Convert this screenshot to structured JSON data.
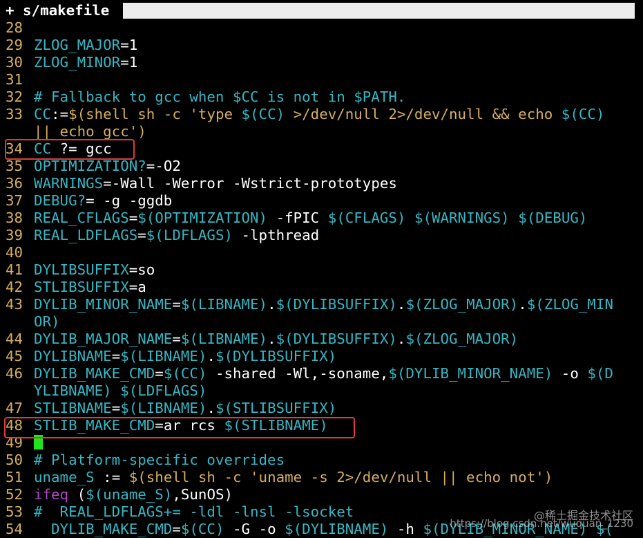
{
  "tab": {
    "title": "+ s/makefile"
  },
  "lines": [
    {
      "num": "28",
      "segs": []
    },
    {
      "num": "29",
      "segs": [
        {
          "t": "ZLOG_MAJOR",
          "c": "var"
        },
        {
          "t": "=1",
          "c": "txt"
        }
      ]
    },
    {
      "num": "30",
      "segs": [
        {
          "t": "ZLOG_MINOR",
          "c": "var"
        },
        {
          "t": "=1",
          "c": "txt"
        }
      ]
    },
    {
      "num": "31",
      "segs": []
    },
    {
      "num": "32",
      "segs": [
        {
          "t": "# Fallback to gcc when $CC is not in $PATH.",
          "c": "cmt"
        }
      ]
    },
    {
      "num": "33",
      "segs": [
        {
          "t": "CC",
          "c": "var"
        },
        {
          "t": ":=",
          "c": "txt"
        },
        {
          "t": "$(shell sh -c 'type ",
          "c": "str"
        },
        {
          "t": "$(CC)",
          "c": "var"
        },
        {
          "t": " >/dev/null 2>/dev/null && echo ",
          "c": "str"
        },
        {
          "t": "$(CC)",
          "c": "var"
        }
      ]
    },
    {
      "num": "",
      "segs": [
        {
          "t": "|| echo gcc')",
          "c": "str"
        }
      ]
    },
    {
      "num": "34",
      "segs": [
        {
          "t": "CC",
          "c": "var"
        },
        {
          "t": " ?= gcc",
          "c": "txt"
        }
      ]
    },
    {
      "num": "35",
      "segs": [
        {
          "t": "OPTIMIZATION?",
          "c": "var"
        },
        {
          "t": "=-O2",
          "c": "txt"
        }
      ]
    },
    {
      "num": "36",
      "segs": [
        {
          "t": "WARNINGS",
          "c": "var"
        },
        {
          "t": "=-Wall -Werror -Wstrict-prototypes",
          "c": "txt"
        }
      ]
    },
    {
      "num": "37",
      "segs": [
        {
          "t": "DEBUG?",
          "c": "var"
        },
        {
          "t": "= -g -ggdb",
          "c": "txt"
        }
      ]
    },
    {
      "num": "38",
      "segs": [
        {
          "t": "REAL_CFLAGS",
          "c": "var"
        },
        {
          "t": "=",
          "c": "txt"
        },
        {
          "t": "$(OPTIMIZATION)",
          "c": "var"
        },
        {
          "t": " -fPIC ",
          "c": "txt"
        },
        {
          "t": "$(CFLAGS)",
          "c": "var"
        },
        {
          "t": " ",
          "c": "txt"
        },
        {
          "t": "$(WARNINGS)",
          "c": "var"
        },
        {
          "t": " ",
          "c": "txt"
        },
        {
          "t": "$(DEBUG)",
          "c": "var"
        }
      ]
    },
    {
      "num": "39",
      "segs": [
        {
          "t": "REAL_LDFLAGS",
          "c": "var"
        },
        {
          "t": "=",
          "c": "txt"
        },
        {
          "t": "$(LDFLAGS)",
          "c": "var"
        },
        {
          "t": " -lpthread",
          "c": "txt"
        }
      ]
    },
    {
      "num": "40",
      "segs": []
    },
    {
      "num": "41",
      "segs": [
        {
          "t": "DYLIBSUFFIX",
          "c": "var"
        },
        {
          "t": "=so",
          "c": "txt"
        }
      ]
    },
    {
      "num": "42",
      "segs": [
        {
          "t": "STLIBSUFFIX",
          "c": "var"
        },
        {
          "t": "=a",
          "c": "txt"
        }
      ]
    },
    {
      "num": "43",
      "segs": [
        {
          "t": "DYLIB_MINOR_NAME",
          "c": "var"
        },
        {
          "t": "=",
          "c": "txt"
        },
        {
          "t": "$(LIBNAME)",
          "c": "var"
        },
        {
          "t": ".",
          "c": "txt"
        },
        {
          "t": "$(DYLIBSUFFIX)",
          "c": "var"
        },
        {
          "t": ".",
          "c": "txt"
        },
        {
          "t": "$(ZLOG_MAJOR)",
          "c": "var"
        },
        {
          "t": ".",
          "c": "txt"
        },
        {
          "t": "$(ZLOG_MIN",
          "c": "var"
        }
      ]
    },
    {
      "num": "",
      "segs": [
        {
          "t": "OR)",
          "c": "var"
        }
      ]
    },
    {
      "num": "44",
      "segs": [
        {
          "t": "DYLIB_MAJOR_NAME",
          "c": "var"
        },
        {
          "t": "=",
          "c": "txt"
        },
        {
          "t": "$(LIBNAME)",
          "c": "var"
        },
        {
          "t": ".",
          "c": "txt"
        },
        {
          "t": "$(DYLIBSUFFIX)",
          "c": "var"
        },
        {
          "t": ".",
          "c": "txt"
        },
        {
          "t": "$(ZLOG_MAJOR)",
          "c": "var"
        }
      ]
    },
    {
      "num": "45",
      "segs": [
        {
          "t": "DYLIBNAME",
          "c": "var"
        },
        {
          "t": "=",
          "c": "txt"
        },
        {
          "t": "$(LIBNAME)",
          "c": "var"
        },
        {
          "t": ".",
          "c": "txt"
        },
        {
          "t": "$(DYLIBSUFFIX)",
          "c": "var"
        }
      ]
    },
    {
      "num": "46",
      "segs": [
        {
          "t": "DYLIB_MAKE_CMD",
          "c": "var"
        },
        {
          "t": "=",
          "c": "txt"
        },
        {
          "t": "$(CC)",
          "c": "var"
        },
        {
          "t": " -shared -Wl,-soname,",
          "c": "txt"
        },
        {
          "t": "$(DYLIB_MINOR_NAME)",
          "c": "var"
        },
        {
          "t": " -o ",
          "c": "txt"
        },
        {
          "t": "$(D",
          "c": "var"
        }
      ]
    },
    {
      "num": "",
      "segs": [
        {
          "t": "YLIBNAME)",
          "c": "var"
        },
        {
          "t": " ",
          "c": "txt"
        },
        {
          "t": "$(LDFLAGS)",
          "c": "var"
        }
      ]
    },
    {
      "num": "47",
      "segs": [
        {
          "t": "STLIBNAME",
          "c": "var"
        },
        {
          "t": "=",
          "c": "txt"
        },
        {
          "t": "$(LIBNAME)",
          "c": "var"
        },
        {
          "t": ".",
          "c": "txt"
        },
        {
          "t": "$(STLIBSUFFIX)",
          "c": "var"
        }
      ]
    },
    {
      "num": "48",
      "segs": [
        {
          "t": "STLIB_MAKE_CMD",
          "c": "var"
        },
        {
          "t": "=ar rcs ",
          "c": "txt"
        },
        {
          "t": "$(STLIBNAME)",
          "c": "var"
        }
      ]
    },
    {
      "num": "49",
      "segs": [
        {
          "t": "",
          "c": "cursor"
        }
      ]
    },
    {
      "num": "50",
      "segs": [
        {
          "t": "# Platform-specific overrides",
          "c": "cmt"
        }
      ]
    },
    {
      "num": "51",
      "segs": [
        {
          "t": "uname_S",
          "c": "var"
        },
        {
          "t": " := ",
          "c": "txt"
        },
        {
          "t": "$(shell sh -c 'uname -s 2>/dev/null || echo not')",
          "c": "str"
        }
      ]
    },
    {
      "num": "52",
      "segs": [
        {
          "t": "ifeq",
          "c": "kw"
        },
        {
          "t": " (",
          "c": "txt"
        },
        {
          "t": "$(uname_S)",
          "c": "var"
        },
        {
          "t": ",SunOS)",
          "c": "txt"
        }
      ]
    },
    {
      "num": "53",
      "segs": [
        {
          "t": "#  REAL_LDFLAGS+= -ldl -lnsl -lsocket",
          "c": "cmt"
        }
      ]
    },
    {
      "num": "54",
      "segs": [
        {
          "t": "  DYLIB_MAKE_CMD",
          "c": "var"
        },
        {
          "t": "=",
          "c": "txt"
        },
        {
          "t": "$(CC)",
          "c": "var"
        },
        {
          "t": " -G -o ",
          "c": "txt"
        },
        {
          "t": "$(DYLIBNAME)",
          "c": "var"
        },
        {
          "t": " -h ",
          "c": "txt"
        },
        {
          "t": "$(DYLIB_MINOR_NAME)",
          "c": "var"
        },
        {
          "t": " $(",
          "c": "var"
        }
      ]
    }
  ],
  "colors": {
    "background": "#000000",
    "line_number": "#d7af5f",
    "variable": "#35b7c4",
    "string": "#d7af5f",
    "comment": "#35b7c4",
    "keyword": "#b245c8",
    "cursor": "#1ee61e",
    "highlight_box": "#e23a3a"
  },
  "watermark": {
    "brand": "@稀土掘金技术社区",
    "url": "https://blog.csdn.net/wuquan_1230"
  }
}
